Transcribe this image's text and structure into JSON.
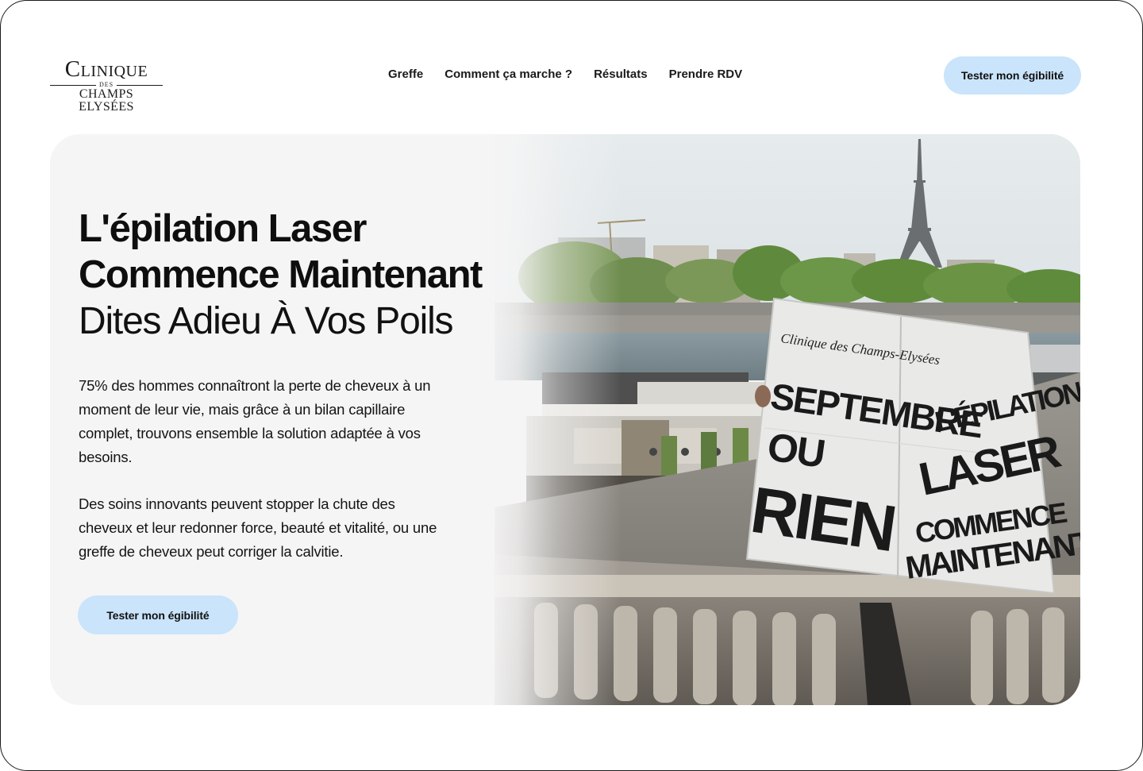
{
  "brand": {
    "line1": "Clinique",
    "line2": "des",
    "line3": "Champs Elysées"
  },
  "nav": {
    "items": [
      {
        "label": "Greffe"
      },
      {
        "label": "Comment ça marche ?"
      },
      {
        "label": "Résultats"
      },
      {
        "label": "Prendre RDV"
      }
    ]
  },
  "header": {
    "cta_label": "Tester mon égibilité"
  },
  "hero": {
    "headline_line1": "L'épilation Laser",
    "headline_line2": "Commence Maintenant",
    "subheadline": "Dites Adieu À Vos Poils",
    "paragraph1": "75% des hommes connaîtront la perte de cheveux à un moment de leur vie, mais grâce à un bilan capillaire complet, trouvons ensemble la solution adaptée à vos besoins.",
    "paragraph2": "Des soins innovants peuvent stopper la chute des cheveux et leur redonner force, beauté et vitalité, ou une greffe de cheveux peut corriger la calvitie.",
    "cta_label": "Tester mon égibilité"
  },
  "newspaper": {
    "masthead": "Clinique des Champs-Elysées",
    "left_line1": "SEPTEMBRE",
    "left_line2": "OU",
    "left_line3": "RIEN",
    "right_line1": "L'ÉPILATION",
    "right_line2": "LASER",
    "right_line3": "COMMENCE",
    "right_line4": "MAINTENANT"
  },
  "colors": {
    "accent": "#c9e4fb",
    "hero_background": "#f5f5f5",
    "text": "#111111"
  }
}
